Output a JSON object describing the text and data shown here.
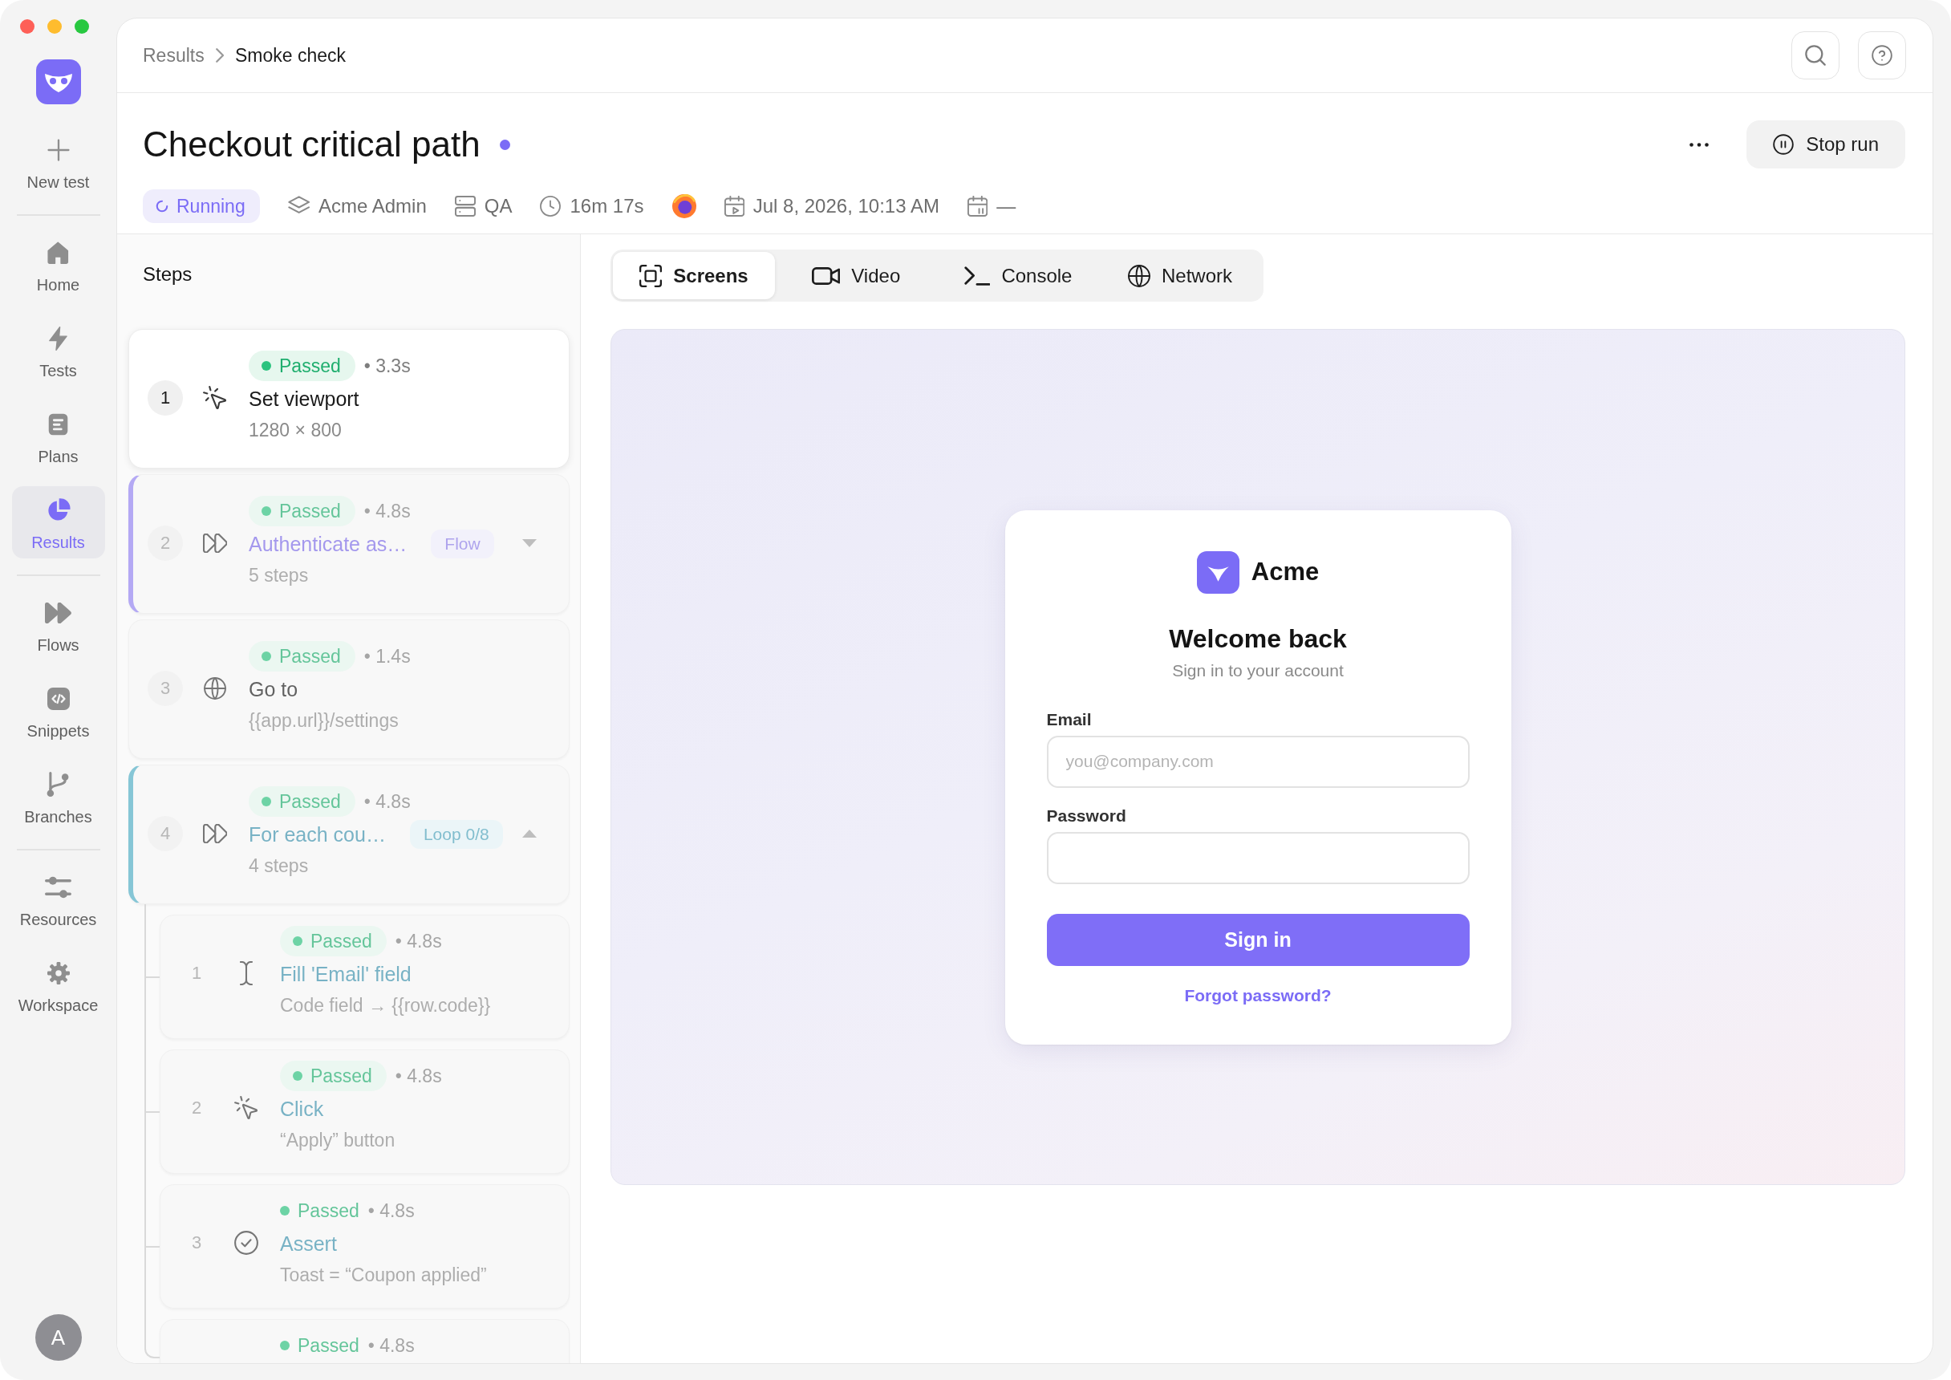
{
  "sidebar": {
    "new_test": {
      "label": "New test"
    },
    "sections": [
      {
        "items": [
          {
            "label": "Home",
            "selected": false
          },
          {
            "label": "Tests",
            "selected": false
          },
          {
            "label": "Plans",
            "selected": false
          },
          {
            "label": "Results",
            "selected": true
          }
        ]
      },
      {
        "items": [
          {
            "label": "Flows",
            "selected": false
          },
          {
            "label": "Snippets",
            "selected": false
          },
          {
            "label": "Branches",
            "selected": false
          }
        ]
      },
      {
        "items": [
          {
            "label": "Resources",
            "selected": false
          },
          {
            "label": "Workspace",
            "selected": false
          }
        ]
      }
    ],
    "avatar": {
      "initial": "A"
    }
  },
  "breadcrumb": [
    {
      "label": "Results",
      "current": false
    },
    {
      "label": "Smoke check",
      "current": true
    }
  ],
  "run": {
    "title": "Checkout critical path",
    "live": true,
    "status": {
      "label": "Running",
      "kind": "running"
    },
    "meta": [
      {
        "kind": "project",
        "text": "Acme Admin"
      },
      {
        "kind": "environment",
        "text": "QA"
      },
      {
        "kind": "duration",
        "text": "16m 17s"
      },
      {
        "kind": "browser"
      },
      {
        "kind": "started",
        "text": "Jul 8, 2026, 10:13 AM"
      },
      {
        "kind": "schedule",
        "text": "—"
      }
    ],
    "stop_label": "Stop run"
  },
  "steps_panel": {
    "title": "Steps",
    "steps": [
      {
        "number": "1",
        "kind": "click",
        "status": {
          "label": "Passed",
          "kind": "passed",
          "pill": true
        },
        "duration": "• 3.3s",
        "title": "Set viewport",
        "detail": "1280 × 800",
        "selected": true
      },
      {
        "number": "2",
        "kind": "flow",
        "status": {
          "label": "Passed",
          "kind": "passed",
          "pill": true
        },
        "duration": "• 4.8s",
        "title": "Authenticate as…",
        "tag": "Flow",
        "detail": "5 steps",
        "selected": false,
        "expanded": false
      },
      {
        "number": "3",
        "kind": "goto",
        "status": {
          "label": "Passed",
          "kind": "passed",
          "pill": true
        },
        "duration": "• 1.4s",
        "title": "Go to",
        "detail": "{{app.url}}/settings",
        "selected": false
      },
      {
        "number": "4",
        "kind": "loop",
        "status": {
          "label": "Passed",
          "kind": "passed",
          "pill": true
        },
        "duration": "• 4.8s",
        "title": "For each cou…",
        "tag": "Loop 0/8",
        "detail": "4 steps",
        "selected": false,
        "expanded": true,
        "children": [
          {
            "number": "1",
            "kind": "fill",
            "status": {
              "label": "Passed",
              "kind": "passed",
              "pill": true
            },
            "duration": "• 4.8s",
            "title": "Fill 'Email' field",
            "detail": "Code field → {{row.code}}",
            "selected": false
          },
          {
            "number": "2",
            "kind": "click",
            "status": {
              "label": "Passed",
              "kind": "passed",
              "pill": true
            },
            "duration": "• 4.8s",
            "title": "Click",
            "detail": "“Apply” button",
            "selected": false
          },
          {
            "number": "3",
            "kind": "assert",
            "status": {
              "label": "Passed",
              "kind": "passed",
              "pill": false
            },
            "duration": "• 4.8s",
            "title": "Assert",
            "detail": "Toast = “Coupon applied”",
            "selected": false
          },
          {
            "status": {
              "label": "Passed",
              "kind": "passed",
              "pill": false
            },
            "duration": "• 4.8s",
            "selected": false
          }
        ]
      }
    ]
  },
  "viewer": {
    "tabs": [
      {
        "label": "Screens",
        "selected": true
      },
      {
        "label": "Video",
        "selected": false
      },
      {
        "label": "Console",
        "selected": false
      },
      {
        "label": "Network",
        "selected": false
      }
    ],
    "screenshot": {
      "brand": "Acme",
      "heading": "Welcome back",
      "subheading": "Sign in to your account",
      "fields": [
        {
          "label": "Email",
          "placeholder": "you@company.com"
        },
        {
          "label": "Password"
        }
      ],
      "submit_label": "Sign in",
      "link": "Forgot password?"
    }
  }
}
